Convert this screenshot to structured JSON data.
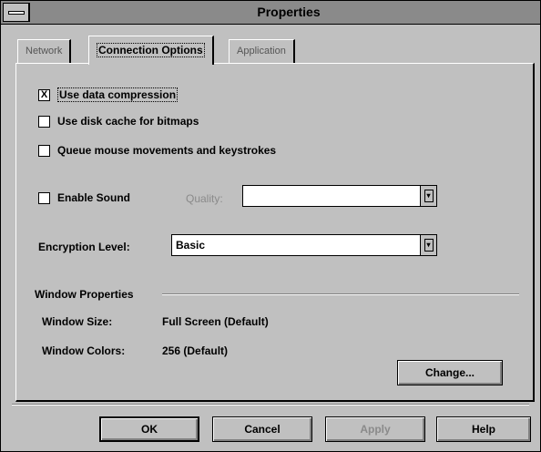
{
  "window": {
    "title": "Properties"
  },
  "tabs": [
    {
      "label": "Network",
      "active": false
    },
    {
      "label": "Connection Options",
      "active": true
    },
    {
      "label": "Application",
      "active": false
    }
  ],
  "options": {
    "use_compression": {
      "label": "Use data compression",
      "checked": true,
      "mark": "X"
    },
    "disk_cache": {
      "label": "Use disk cache for bitmaps",
      "checked": false
    },
    "queue_input": {
      "label": "Queue mouse movements and keystrokes",
      "checked": false
    },
    "enable_sound": {
      "label": "Enable Sound",
      "checked": false
    }
  },
  "quality": {
    "label": "Quality:",
    "value": ""
  },
  "encryption": {
    "label": "Encryption Level:",
    "value": "Basic"
  },
  "window_properties": {
    "heading": "Window Properties",
    "size_label": "Window Size:",
    "size_value": "Full Screen  (Default)",
    "colors_label": "Window Colors:",
    "colors_value": "256 (Default)",
    "change_label": "Change..."
  },
  "buttons": {
    "ok": "OK",
    "cancel": "Cancel",
    "apply": "Apply",
    "help": "Help"
  },
  "colors": {
    "face": "#c0c0c0",
    "titlebar": "#8a8a8a",
    "disabled_text": "#8a8a8a"
  }
}
